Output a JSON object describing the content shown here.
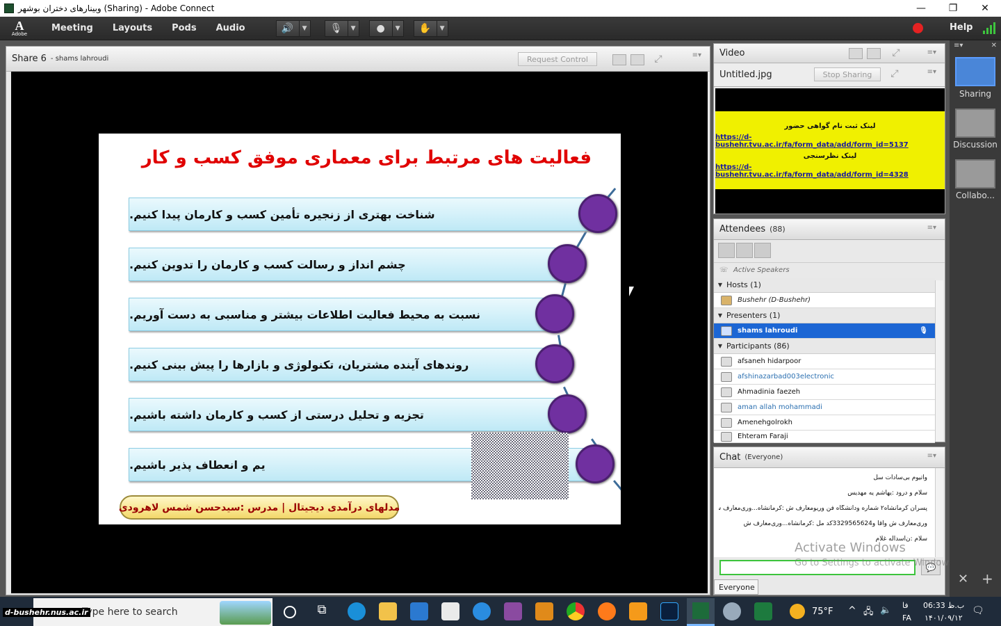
{
  "window": {
    "title": "وبینارهای دختران بوشهر (Sharing) - Adobe Connect",
    "min": "—",
    "max": "❐",
    "close": "✕"
  },
  "menubar": {
    "logo_letter": "A",
    "logo_text": "Adobe",
    "items": [
      "Meeting",
      "Layouts",
      "Pods",
      "Audio"
    ],
    "help": "Help",
    "speaker_icon": "speaker-icon",
    "mic_icon": "microphone-icon",
    "camera_icon": "webcam-icon",
    "hand_icon": "raise-hand-icon"
  },
  "share_pod": {
    "title": "Share 6",
    "presenter": "- shams lahroudi",
    "request_control": "Request Control"
  },
  "slide": {
    "title": "فعالیت های مرتبط برای  معماری موفق کسب و کار",
    "items": [
      "شناخت بهتری از زنجیره تأمین کسب و کارمان پیدا کنیم.",
      "چشم انداز و رسالت کسب و کارمان را تدوین کنیم.",
      "نسبت به محیط فعالیت اطلاعات بیشتر و مناسبی به دست آوریم.",
      "روندهای آینده مشتریان، تکنولوژی و بازارها را پیش بینی کنیم.",
      "تجزیه و تحلیل درستی از کسب و کارمان داشته باشیم.",
      "یم و انعطاف پذیر باشیم."
    ],
    "footer": "مدلهای درآمدی دیجیتال | مدرس :سیدحسن شمس لاهرودی"
  },
  "video_pod": {
    "title": "Video",
    "file_name": "Untitled.jpg",
    "stop_sharing": "Stop Sharing",
    "image_line1": "لینک ثبت نام گواهی حضور",
    "image_link1": "https://d-bushehr.tvu.ac.ir/fa/form_data/add/form_id=5137",
    "image_line2": "لینک نظرسنجی",
    "image_link2": "https://d-bushehr.tvu.ac.ir/fa/form_data/add/form_id=4328"
  },
  "attendees": {
    "title": "Attendees",
    "count": "(88)",
    "active_speakers": "Active Speakers",
    "hosts_label": "Hosts (1)",
    "host_name": "Bushehr (D-Bushehr)",
    "presenters_label": "Presenters (1)",
    "presenter_name": "shams lahroudi",
    "participants_label": "Participants (86)",
    "participants": [
      {
        "name": "afsaneh hidarpoor",
        "color": "#111111"
      },
      {
        "name": "afshinazarbad003electronic",
        "color": "#2a6fb0"
      },
      {
        "name": "Ahmadinia faezeh",
        "color": "#111111"
      },
      {
        "name": "aman allah mohammadi",
        "color": "#2a6fb0"
      },
      {
        "name": "Amenehgolrokh",
        "color": "#111111"
      },
      {
        "name": "Ehteram Faraji",
        "color": "#111111"
      }
    ]
  },
  "chat": {
    "title": "Chat",
    "scope": "(Everyone)",
    "messages": [
      "واتیوم بی‌سادات سل",
      "سلام و درود :یهاشم یه مهدیس",
      "پسران کرمانشاه۲ شماره ودانشگاه فن وریومعارف ش :کرمانشاه...وری‌معارف ش",
      "وری‌معارف ش وآقا و3329565624کد مل :کرمانشاه...وری‌معارف ش",
      "سلام :ن‌اسداله غلام"
    ],
    "recipient": "Everyone",
    "activate_title": "Activate Windows",
    "activate_sub": "Go to Settings to activate Windows."
  },
  "layouts": {
    "items": [
      "Sharing",
      "Discussion",
      "Collabo..."
    ]
  },
  "taskbar": {
    "search_placeholder": "Type here to search",
    "watermark": "d-bushehr.nus.ac.ir",
    "weather": "75°F",
    "lang": "FA",
    "lang2": "فا",
    "time": "06:33 ب.ظ",
    "date": "۱۴۰۱/۰۹/۱۲"
  }
}
